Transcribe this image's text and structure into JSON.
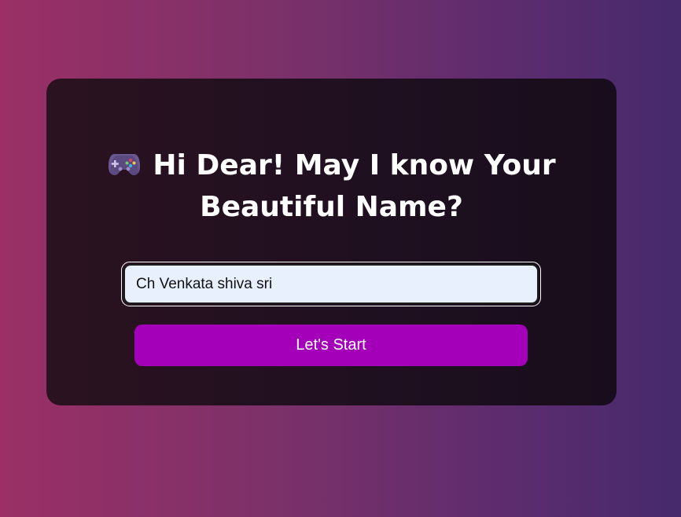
{
  "heading": {
    "icon": "gamepad-icon",
    "line1": "Hi Dear! May I know Your",
    "line2": "Beautiful Name?"
  },
  "name_input": {
    "value": "Ch Venkata shiva sri"
  },
  "start_button": {
    "label": "Let's Start",
    "color": "#a500b9"
  }
}
